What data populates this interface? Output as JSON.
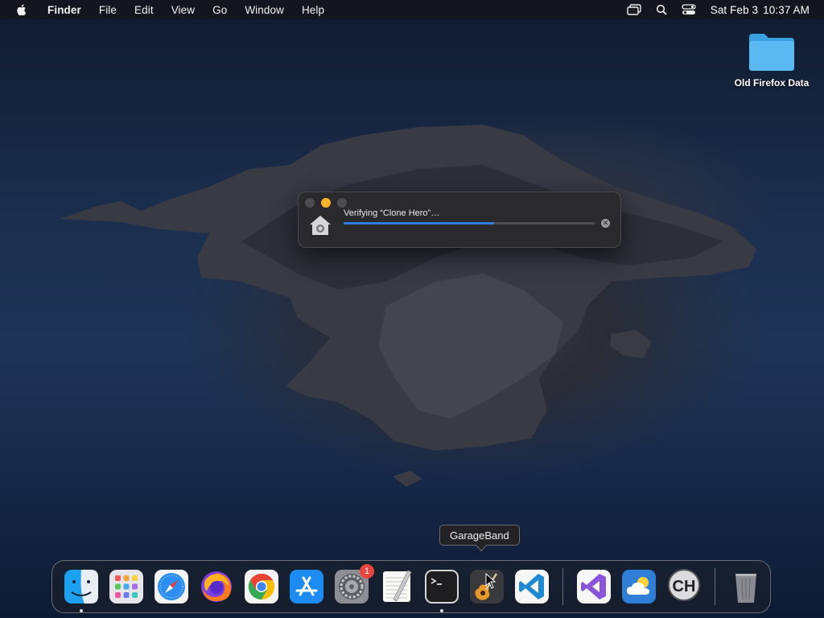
{
  "menubar": {
    "app_name": "Finder",
    "menus": [
      "File",
      "Edit",
      "View",
      "Go",
      "Window",
      "Help"
    ],
    "date": "Sat Feb 3",
    "time": "10:37 AM"
  },
  "desktop": {
    "folder_label": "Old Firefox Data"
  },
  "progress_window": {
    "title": "Verifying “Clone Hero”…",
    "progress_fraction": 0.6
  },
  "tooltip": {
    "label": "GarageBand"
  },
  "dock": {
    "items": [
      {
        "name": "Finder",
        "icon": "finder-icon",
        "running": true
      },
      {
        "name": "Launchpad",
        "icon": "launchpad-icon"
      },
      {
        "name": "Safari",
        "icon": "safari-icon"
      },
      {
        "name": "Firefox",
        "icon": "firefox-icon"
      },
      {
        "name": "Google Chrome",
        "icon": "chrome-icon"
      },
      {
        "name": "App Store",
        "icon": "app-store-icon"
      },
      {
        "name": "System Preferences",
        "icon": "system-preferences-icon",
        "badge": "1"
      },
      {
        "name": "TextEdit",
        "icon": "textedit-icon"
      },
      {
        "name": "Terminal",
        "icon": "terminal-icon",
        "running": true
      },
      {
        "name": "GarageBand",
        "icon": "garageband-icon"
      },
      {
        "name": "Visual Studio Code",
        "icon": "vscode-icon"
      },
      {
        "name": "Visual Studio",
        "icon": "visual-studio-icon"
      },
      {
        "name": "Weather",
        "icon": "weather-icon"
      },
      {
        "name": "Clone Hero",
        "icon": "clone-hero-icon"
      },
      {
        "name": "Trash",
        "icon": "trash-icon"
      }
    ],
    "badge_count": "1",
    "clone_hero_letters": "CH"
  },
  "colors": {
    "accent_blue": "#2f7ee6",
    "minimize_yellow": "#f6b52a",
    "badge_red": "#e8453c"
  }
}
